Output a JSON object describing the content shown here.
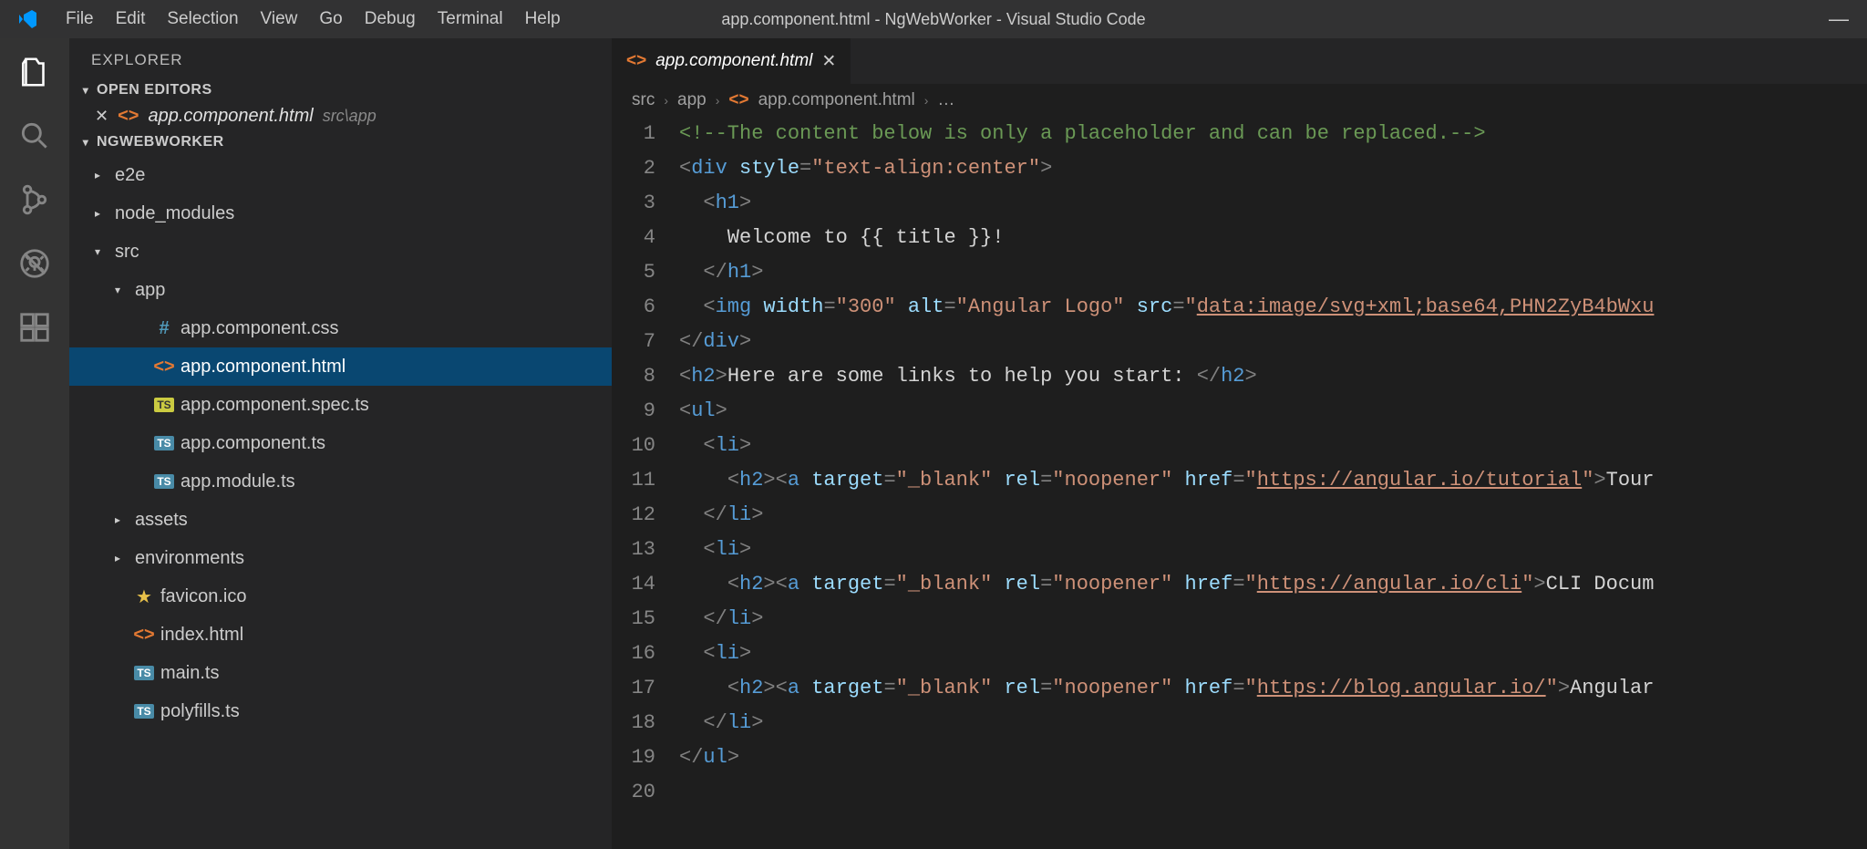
{
  "window": {
    "title": "app.component.html - NgWebWorker - Visual Studio Code"
  },
  "menu": [
    "File",
    "Edit",
    "Selection",
    "View",
    "Go",
    "Debug",
    "Terminal",
    "Help"
  ],
  "sidebar": {
    "title": "EXPLORER",
    "openEditorsLabel": "OPEN EDITORS",
    "openEditor": {
      "name": "app.component.html",
      "path": "src\\app"
    },
    "projectLabel": "NGWEBWORKER",
    "tree": [
      {
        "depth": 0,
        "kind": "folder",
        "expanded": false,
        "name": "e2e"
      },
      {
        "depth": 0,
        "kind": "folder",
        "expanded": false,
        "name": "node_modules"
      },
      {
        "depth": 0,
        "kind": "folder",
        "expanded": true,
        "name": "src"
      },
      {
        "depth": 1,
        "kind": "folder",
        "expanded": true,
        "name": "app"
      },
      {
        "depth": 2,
        "kind": "file",
        "icon": "hash",
        "name": "app.component.css"
      },
      {
        "depth": 2,
        "kind": "file",
        "icon": "tag",
        "name": "app.component.html",
        "selected": true
      },
      {
        "depth": 2,
        "kind": "file",
        "icon": "tsy",
        "name": "app.component.spec.ts"
      },
      {
        "depth": 2,
        "kind": "file",
        "icon": "ts",
        "name": "app.component.ts"
      },
      {
        "depth": 2,
        "kind": "file",
        "icon": "ts",
        "name": "app.module.ts"
      },
      {
        "depth": 1,
        "kind": "folder",
        "expanded": false,
        "name": "assets"
      },
      {
        "depth": 1,
        "kind": "folder",
        "expanded": false,
        "name": "environments"
      },
      {
        "depth": 1,
        "kind": "file",
        "icon": "star",
        "name": "favicon.ico"
      },
      {
        "depth": 1,
        "kind": "file",
        "icon": "tag",
        "name": "index.html"
      },
      {
        "depth": 1,
        "kind": "file",
        "icon": "ts",
        "name": "main.ts"
      },
      {
        "depth": 1,
        "kind": "file",
        "icon": "ts",
        "name": "polyfills.ts"
      }
    ]
  },
  "tab": {
    "name": "app.component.html"
  },
  "breadcrumbs": [
    "src",
    "app",
    "app.component.html",
    "…"
  ],
  "code": [
    [
      {
        "t": "<!--The content below is only a placeholder and can be replaced.-->",
        "c": "comment"
      }
    ],
    [
      {
        "t": "<",
        "c": "punct"
      },
      {
        "t": "div",
        "c": "tag"
      },
      {
        "t": " ",
        "c": "text"
      },
      {
        "t": "style",
        "c": "attr"
      },
      {
        "t": "=",
        "c": "punct"
      },
      {
        "t": "\"text-align:center\"",
        "c": "str"
      },
      {
        "t": ">",
        "c": "punct"
      }
    ],
    [
      {
        "t": "  ",
        "c": "text"
      },
      {
        "t": "<",
        "c": "punct"
      },
      {
        "t": "h1",
        "c": "tag"
      },
      {
        "t": ">",
        "c": "punct"
      }
    ],
    [
      {
        "t": "    Welcome to {{ title }}!",
        "c": "text"
      }
    ],
    [
      {
        "t": "  ",
        "c": "text"
      },
      {
        "t": "</",
        "c": "punct"
      },
      {
        "t": "h1",
        "c": "tag"
      },
      {
        "t": ">",
        "c": "punct"
      }
    ],
    [
      {
        "t": "  ",
        "c": "text"
      },
      {
        "t": "<",
        "c": "punct"
      },
      {
        "t": "img",
        "c": "tag"
      },
      {
        "t": " ",
        "c": "text"
      },
      {
        "t": "width",
        "c": "attr"
      },
      {
        "t": "=",
        "c": "punct"
      },
      {
        "t": "\"300\"",
        "c": "str"
      },
      {
        "t": " ",
        "c": "text"
      },
      {
        "t": "alt",
        "c": "attr"
      },
      {
        "t": "=",
        "c": "punct"
      },
      {
        "t": "\"Angular Logo\"",
        "c": "str"
      },
      {
        "t": " ",
        "c": "text"
      },
      {
        "t": "src",
        "c": "attr"
      },
      {
        "t": "=",
        "c": "punct"
      },
      {
        "t": "\"",
        "c": "str"
      },
      {
        "t": "data:image/svg+xml;base64,PHN2ZyB4bWxu",
        "c": "url"
      }
    ],
    [
      {
        "t": "</",
        "c": "punct"
      },
      {
        "t": "div",
        "c": "tag"
      },
      {
        "t": ">",
        "c": "punct"
      }
    ],
    [
      {
        "t": "<",
        "c": "punct"
      },
      {
        "t": "h2",
        "c": "tag"
      },
      {
        "t": ">",
        "c": "punct"
      },
      {
        "t": "Here are some links to help you start: ",
        "c": "text"
      },
      {
        "t": "</",
        "c": "punct"
      },
      {
        "t": "h2",
        "c": "tag"
      },
      {
        "t": ">",
        "c": "punct"
      }
    ],
    [
      {
        "t": "<",
        "c": "punct"
      },
      {
        "t": "ul",
        "c": "tag"
      },
      {
        "t": ">",
        "c": "punct"
      }
    ],
    [
      {
        "t": "  ",
        "c": "text"
      },
      {
        "t": "<",
        "c": "punct"
      },
      {
        "t": "li",
        "c": "tag"
      },
      {
        "t": ">",
        "c": "punct"
      }
    ],
    [
      {
        "t": "    ",
        "c": "text"
      },
      {
        "t": "<",
        "c": "punct"
      },
      {
        "t": "h2",
        "c": "tag"
      },
      {
        "t": "><",
        "c": "punct"
      },
      {
        "t": "a",
        "c": "tag"
      },
      {
        "t": " ",
        "c": "text"
      },
      {
        "t": "target",
        "c": "attr"
      },
      {
        "t": "=",
        "c": "punct"
      },
      {
        "t": "\"_blank\"",
        "c": "str"
      },
      {
        "t": " ",
        "c": "text"
      },
      {
        "t": "rel",
        "c": "attr"
      },
      {
        "t": "=",
        "c": "punct"
      },
      {
        "t": "\"noopener\"",
        "c": "str"
      },
      {
        "t": " ",
        "c": "text"
      },
      {
        "t": "href",
        "c": "attr"
      },
      {
        "t": "=",
        "c": "punct"
      },
      {
        "t": "\"",
        "c": "str"
      },
      {
        "t": "https://angular.io/tutorial",
        "c": "url"
      },
      {
        "t": "\"",
        "c": "str"
      },
      {
        "t": ">",
        "c": "punct"
      },
      {
        "t": "Tour",
        "c": "text"
      }
    ],
    [
      {
        "t": "  ",
        "c": "text"
      },
      {
        "t": "</",
        "c": "punct"
      },
      {
        "t": "li",
        "c": "tag"
      },
      {
        "t": ">",
        "c": "punct"
      }
    ],
    [
      {
        "t": "  ",
        "c": "text"
      },
      {
        "t": "<",
        "c": "punct"
      },
      {
        "t": "li",
        "c": "tag"
      },
      {
        "t": ">",
        "c": "punct"
      }
    ],
    [
      {
        "t": "    ",
        "c": "text"
      },
      {
        "t": "<",
        "c": "punct"
      },
      {
        "t": "h2",
        "c": "tag"
      },
      {
        "t": "><",
        "c": "punct"
      },
      {
        "t": "a",
        "c": "tag"
      },
      {
        "t": " ",
        "c": "text"
      },
      {
        "t": "target",
        "c": "attr"
      },
      {
        "t": "=",
        "c": "punct"
      },
      {
        "t": "\"_blank\"",
        "c": "str"
      },
      {
        "t": " ",
        "c": "text"
      },
      {
        "t": "rel",
        "c": "attr"
      },
      {
        "t": "=",
        "c": "punct"
      },
      {
        "t": "\"noopener\"",
        "c": "str"
      },
      {
        "t": " ",
        "c": "text"
      },
      {
        "t": "href",
        "c": "attr"
      },
      {
        "t": "=",
        "c": "punct"
      },
      {
        "t": "\"",
        "c": "str"
      },
      {
        "t": "https://angular.io/cli",
        "c": "url"
      },
      {
        "t": "\"",
        "c": "str"
      },
      {
        "t": ">",
        "c": "punct"
      },
      {
        "t": "CLI Docum",
        "c": "text"
      }
    ],
    [
      {
        "t": "  ",
        "c": "text"
      },
      {
        "t": "</",
        "c": "punct"
      },
      {
        "t": "li",
        "c": "tag"
      },
      {
        "t": ">",
        "c": "punct"
      }
    ],
    [
      {
        "t": "  ",
        "c": "text"
      },
      {
        "t": "<",
        "c": "punct"
      },
      {
        "t": "li",
        "c": "tag"
      },
      {
        "t": ">",
        "c": "punct"
      }
    ],
    [
      {
        "t": "    ",
        "c": "text"
      },
      {
        "t": "<",
        "c": "punct"
      },
      {
        "t": "h2",
        "c": "tag"
      },
      {
        "t": "><",
        "c": "punct"
      },
      {
        "t": "a",
        "c": "tag"
      },
      {
        "t": " ",
        "c": "text"
      },
      {
        "t": "target",
        "c": "attr"
      },
      {
        "t": "=",
        "c": "punct"
      },
      {
        "t": "\"_blank\"",
        "c": "str"
      },
      {
        "t": " ",
        "c": "text"
      },
      {
        "t": "rel",
        "c": "attr"
      },
      {
        "t": "=",
        "c": "punct"
      },
      {
        "t": "\"noopener\"",
        "c": "str"
      },
      {
        "t": " ",
        "c": "text"
      },
      {
        "t": "href",
        "c": "attr"
      },
      {
        "t": "=",
        "c": "punct"
      },
      {
        "t": "\"",
        "c": "str"
      },
      {
        "t": "https://blog.angular.io/",
        "c": "url"
      },
      {
        "t": "\"",
        "c": "str"
      },
      {
        "t": ">",
        "c": "punct"
      },
      {
        "t": "Angular",
        "c": "text"
      }
    ],
    [
      {
        "t": "  ",
        "c": "text"
      },
      {
        "t": "</",
        "c": "punct"
      },
      {
        "t": "li",
        "c": "tag"
      },
      {
        "t": ">",
        "c": "punct"
      }
    ],
    [
      {
        "t": "</",
        "c": "punct"
      },
      {
        "t": "ul",
        "c": "tag"
      },
      {
        "t": ">",
        "c": "punct"
      }
    ],
    []
  ]
}
